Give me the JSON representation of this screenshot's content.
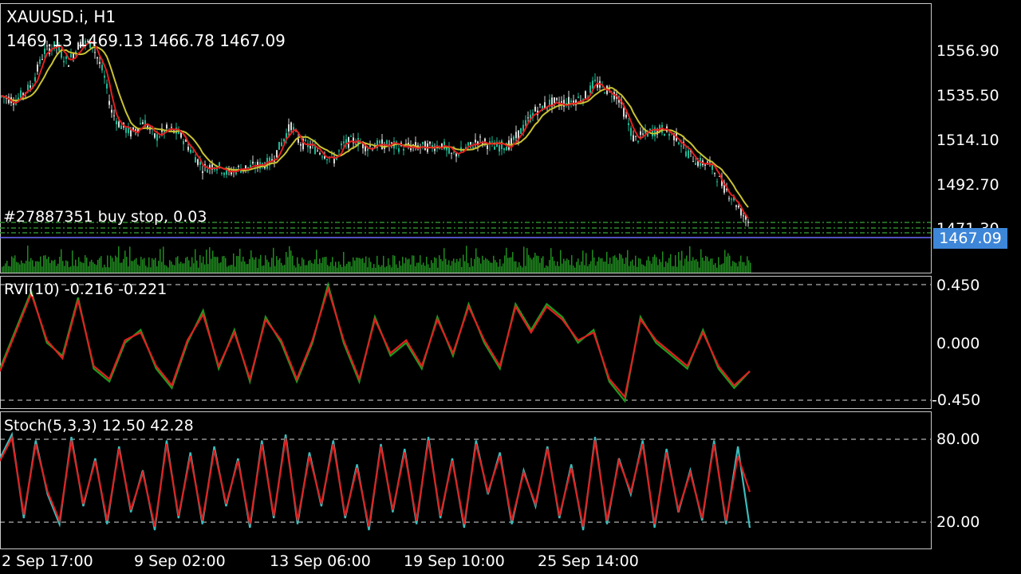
{
  "header": {
    "symbol": "XAUUSD.i, H1",
    "ohlc": "1469.13 1469.13 1466.78 1467.09"
  },
  "order_label": "#27887351 buy stop, 0.03",
  "current_price": "1467.09",
  "price_axis": [
    "1556.90",
    "1535.50",
    "1514.10",
    "1492.70",
    "1471.30"
  ],
  "rvi": {
    "label": "RVI(10) -0.216 -0.221",
    "levels": [
      "0.450",
      "0.000",
      "-0.450"
    ]
  },
  "stoch": {
    "label": "Stoch(5,3,3) 12.50 42.28",
    "levels": [
      "80.00",
      "20.00"
    ]
  },
  "time_axis": [
    "2 Sep 17:00",
    "9 Sep 02:00",
    "13 Sep 06:00",
    "19 Sep 10:00",
    "25 Sep 14:00"
  ],
  "colors": {
    "bull": "#1fb894",
    "bear": "#d9d9d9",
    "ma_fast": "#e02020",
    "ma_slow": "#c9c232",
    "volume": "#1f8a1f",
    "rvi_main": "#1f9a1f",
    "rvi_signal": "#e02020",
    "stoch_main": "#3bbcbc",
    "stoch_signal": "#e02020",
    "price_line": "#6a6aff",
    "order_line": "#2e8b2e",
    "tag_bg": "#3d86d8"
  },
  "chart_data": [
    {
      "type": "line",
      "name": "price",
      "x": [
        0,
        20,
        40,
        55,
        70,
        85,
        100,
        115,
        130,
        140,
        150,
        165,
        180,
        195,
        210,
        225,
        240,
        255,
        270,
        285,
        300,
        320,
        340,
        355,
        365,
        375,
        390,
        410,
        420,
        430,
        445,
        460,
        480,
        500,
        520,
        540,
        555,
        565,
        580,
        600,
        620,
        640,
        655,
        670,
        690,
        705,
        720,
        735,
        745,
        760,
        775,
        785,
        795,
        810,
        830,
        850,
        860,
        875,
        890,
        905,
        920,
        930,
        940
      ],
      "values": [
        1525,
        1523,
        1530,
        1545,
        1548,
        1540,
        1549,
        1549,
        1535,
        1518,
        1512,
        1508,
        1514,
        1506,
        1510,
        1508,
        1500,
        1492,
        1494,
        1490,
        1492,
        1493,
        1495,
        1505,
        1512,
        1504,
        1502,
        1498,
        1496,
        1503,
        1505,
        1502,
        1503,
        1502,
        1502,
        1502,
        1503,
        1498,
        1500,
        1505,
        1502,
        1503,
        1510,
        1518,
        1522,
        1522,
        1523,
        1525,
        1531,
        1528,
        1525,
        1515,
        1505,
        1508,
        1510,
        1506,
        1500,
        1495,
        1494,
        1485,
        1478,
        1472,
        1467
      ],
      "ylim": [
        1460,
        1565
      ]
    },
    {
      "type": "line",
      "name": "RVI(10)",
      "series": [
        {
          "values": [
            -0.2,
            0.1,
            0.4,
            0.0,
            -0.1,
            0.35,
            -0.2,
            -0.3,
            0.0,
            0.1,
            -0.2,
            -0.35,
            0.0,
            0.25,
            -0.2,
            0.1,
            -0.3,
            0.2,
            0.0,
            -0.3,
            0.0,
            0.45,
            0.0,
            -0.3,
            0.2,
            -0.1,
            0.0,
            -0.2,
            0.2,
            -0.1,
            0.3,
            0.0,
            -0.2,
            0.3,
            0.1,
            0.3,
            0.2,
            0.0,
            0.1,
            -0.3,
            -0.45,
            0.2,
            0.0,
            -0.1,
            -0.2,
            0.1,
            -0.2,
            -0.35,
            -0.22
          ]
        },
        {
          "values": [
            -0.22,
            0.08,
            0.38,
            0.02,
            -0.12,
            0.33,
            -0.18,
            -0.28,
            0.02,
            0.08,
            -0.18,
            -0.33,
            0.02,
            0.22,
            -0.18,
            0.08,
            -0.28,
            0.18,
            0.02,
            -0.28,
            0.02,
            0.42,
            0.02,
            -0.28,
            0.18,
            -0.08,
            0.02,
            -0.18,
            0.18,
            -0.08,
            0.28,
            0.02,
            -0.18,
            0.28,
            0.08,
            0.28,
            0.18,
            0.02,
            0.08,
            -0.28,
            -0.42,
            0.18,
            0.02,
            -0.08,
            -0.18,
            0.08,
            -0.18,
            -0.33,
            -0.22
          ]
        }
      ],
      "ylim": [
        -0.5,
        0.5
      ]
    },
    {
      "type": "line",
      "name": "Stoch(5,3,3)",
      "series": [
        {
          "values": [
            70,
            90,
            20,
            85,
            40,
            15,
            88,
            30,
            70,
            15,
            80,
            25,
            60,
            10,
            85,
            20,
            75,
            15,
            80,
            30,
            70,
            12,
            85,
            20,
            90,
            15,
            75,
            30,
            85,
            20,
            65,
            10,
            82,
            25,
            78,
            15,
            88,
            20,
            70,
            12,
            85,
            40,
            75,
            15,
            60,
            30,
            80,
            20,
            65,
            10,
            88,
            15,
            70,
            40,
            85,
            12,
            78,
            25,
            60,
            18,
            85,
            15,
            80,
            12
          ]
        },
        {
          "values": [
            68,
            87,
            23,
            82,
            42,
            18,
            85,
            32,
            68,
            18,
            78,
            27,
            58,
            13,
            82,
            22,
            72,
            18,
            77,
            32,
            68,
            15,
            82,
            22,
            87,
            18,
            72,
            32,
            82,
            22,
            62,
            13,
            80,
            27,
            75,
            18,
            85,
            22,
            68,
            15,
            82,
            42,
            72,
            18,
            58,
            32,
            78,
            22,
            62,
            13,
            85,
            18,
            68,
            42,
            82,
            15,
            75,
            27,
            58,
            20,
            82,
            18,
            72,
            42
          ]
        }
      ],
      "ylim": [
        0,
        100
      ]
    }
  ]
}
